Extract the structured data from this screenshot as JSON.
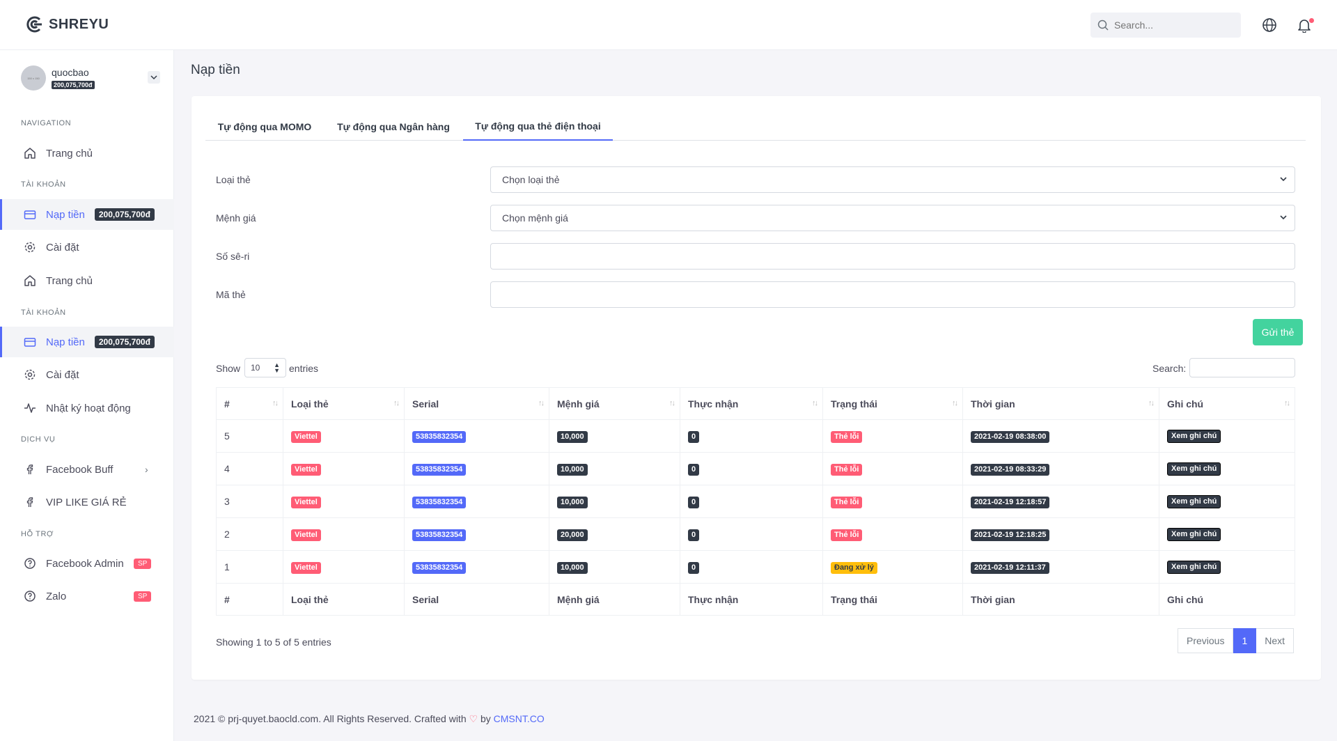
{
  "brand": {
    "name": "SHREYU"
  },
  "topbar": {
    "search_placeholder": "Search..."
  },
  "user": {
    "name": "quocbao",
    "balance": "200,075,700đ",
    "avatar_text": "150 x 150"
  },
  "sidebar": {
    "sections": [
      {
        "title": "NAVIGATION"
      },
      {
        "title": "TÀI KHOẢN"
      },
      {
        "title": "TÀI KHOẢN"
      },
      {
        "title": "DỊCH VỤ"
      },
      {
        "title": "HỖ TRỢ"
      }
    ],
    "items": [
      {
        "label": "Trang chủ"
      },
      {
        "label": "Nạp tiền",
        "badge": "200,075,700đ"
      },
      {
        "label": "Cài đặt"
      },
      {
        "label": "Trang chủ"
      },
      {
        "label": "Nạp tiền",
        "badge": "200,075,700đ"
      },
      {
        "label": "Cài đặt"
      },
      {
        "label": "Nhật ký hoạt động"
      },
      {
        "label": "Facebook Buff"
      },
      {
        "label": "VIP LIKE GIÁ RẺ"
      },
      {
        "label": "Facebook Admin",
        "badge": "SP"
      },
      {
        "label": "Zalo",
        "badge": "SP"
      }
    ]
  },
  "page": {
    "title": "Nạp tiền"
  },
  "tabs": [
    {
      "label": "Tự động qua MOMO"
    },
    {
      "label": "Tự động qua Ngân hàng"
    },
    {
      "label": "Tự động qua thẻ điện thoại"
    }
  ],
  "form": {
    "card_type": {
      "label": "Loại thẻ",
      "value": "Chọn loại thẻ"
    },
    "denomination": {
      "label": "Mệnh giá",
      "value": "Chọn mệnh giá"
    },
    "serial": {
      "label": "Số sê-ri",
      "value": ""
    },
    "code": {
      "label": "Mã thẻ",
      "value": ""
    },
    "submit_label": "Gửi thẻ"
  },
  "datatable": {
    "show_label": "Show",
    "entries_label": "entries",
    "length_value": "10",
    "search_label": "Search:",
    "columns": [
      "#",
      "Loại thẻ",
      "Serial",
      "Mệnh giá",
      "Thực nhận",
      "Trạng thái",
      "Thời gian",
      "Ghi chú"
    ],
    "rows": [
      {
        "id": "5",
        "type": "Viettel",
        "serial": "53835832354",
        "value": "10,000",
        "received": "0",
        "status": "Thẻ lỗi",
        "status_kind": "error",
        "time": "2021-02-19 08:38:00",
        "note": "Xem ghi chú"
      },
      {
        "id": "4",
        "type": "Viettel",
        "serial": "53835832354",
        "value": "10,000",
        "received": "0",
        "status": "Thẻ lỗi",
        "status_kind": "error",
        "time": "2021-02-19 08:33:29",
        "note": "Xem ghi chú"
      },
      {
        "id": "3",
        "type": "Viettel",
        "serial": "53835832354",
        "value": "10,000",
        "received": "0",
        "status": "Thẻ lỗi",
        "status_kind": "error",
        "time": "2021-02-19 12:18:57",
        "note": "Xem ghi chú"
      },
      {
        "id": "2",
        "type": "Viettel",
        "serial": "53835832354",
        "value": "20,000",
        "received": "0",
        "status": "Thẻ lỗi",
        "status_kind": "error",
        "time": "2021-02-19 12:18:25",
        "note": "Xem ghi chú"
      },
      {
        "id": "1",
        "type": "Viettel",
        "serial": "53835832354",
        "value": "10,000",
        "received": "0",
        "status": "Đang xử lý",
        "status_kind": "pending",
        "time": "2021-02-19 12:11:37",
        "note": "Xem ghi chú"
      }
    ],
    "info": "Showing 1 to 5 of 5 entries",
    "pager": {
      "previous": "Previous",
      "current": "1",
      "next": "Next"
    }
  },
  "footer": {
    "text_before": "2021 © prj-quyet.baocld.com. All Rights Reserved. Crafted with",
    "heart": "♡",
    "text_by": "by",
    "link": "CMSNT.CO"
  },
  "colors": {
    "primary": "#5369f8",
    "success": "#43d39e",
    "danger": "#ff5c75",
    "warning": "#ffbe0b",
    "dark": "#323a46"
  }
}
